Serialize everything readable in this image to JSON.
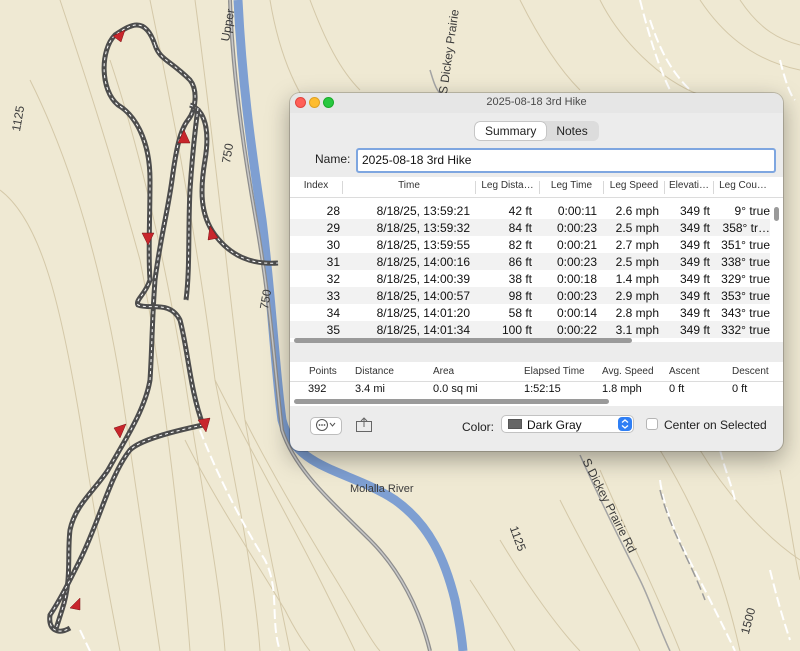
{
  "map": {
    "labels": {
      "upper": "Upper",
      "dickey_top": "S Dickey Prairie",
      "contour_1125_left": "1125",
      "contour_750_a": "750",
      "contour_750_b": "750",
      "molalla": "Molalla River",
      "dickey_bottom": "S Dickey Prairie Rd",
      "contour_1125_right": "1125",
      "contour_1500": "1500"
    }
  },
  "window": {
    "title": "2025-08-18 3rd Hike",
    "tabs": [
      {
        "label": "Summary",
        "active": true
      },
      {
        "label": "Notes",
        "active": false
      }
    ],
    "name_label": "Name:",
    "name_value": "2025-08-18 3rd Hike",
    "points_table": {
      "columns": [
        "Index",
        "Time",
        "Leg Dista…",
        "Leg Time",
        "Leg Speed",
        "Elevati…",
        "Leg Cou…"
      ],
      "rows": [
        [
          "28",
          "8/18/25, 13:59:21",
          "42 ft",
          "0:00:11",
          "2.6 mph",
          "349 ft",
          "9° true"
        ],
        [
          "29",
          "8/18/25, 13:59:32",
          "84 ft",
          "0:00:23",
          "2.5 mph",
          "349 ft",
          "358° tr…"
        ],
        [
          "30",
          "8/18/25, 13:59:55",
          "82 ft",
          "0:00:21",
          "2.7 mph",
          "349 ft",
          "351° true"
        ],
        [
          "31",
          "8/18/25, 14:00:16",
          "86 ft",
          "0:00:23",
          "2.5 mph",
          "349 ft",
          "338° true"
        ],
        [
          "32",
          "8/18/25, 14:00:39",
          "38 ft",
          "0:00:18",
          "1.4 mph",
          "349 ft",
          "329° true"
        ],
        [
          "33",
          "8/18/25, 14:00:57",
          "98 ft",
          "0:00:23",
          "2.9 mph",
          "349 ft",
          "353° true"
        ],
        [
          "34",
          "8/18/25, 14:01:20",
          "58 ft",
          "0:00:14",
          "2.8 mph",
          "349 ft",
          "343° true"
        ],
        [
          "35",
          "8/18/25, 14:01:34",
          "100 ft",
          "0:00:22",
          "3.1 mph",
          "349 ft",
          "332° true"
        ]
      ]
    },
    "summary_table": {
      "columns": [
        "Points",
        "Distance",
        "Area",
        "Elapsed Time",
        "Avg. Speed",
        "Ascent",
        "Descent"
      ],
      "values": [
        "392",
        "3.4 mi",
        "0.0 sq mi",
        "1:52:15",
        "1.8 mph",
        "0 ft",
        "0 ft"
      ]
    },
    "color_label": "Color:",
    "color_value": "Dark Gray",
    "center_label": "Center on Selected",
    "center_checked": false,
    "accent_color": "#2f7ff5",
    "track_color": "#5a5a5a"
  }
}
